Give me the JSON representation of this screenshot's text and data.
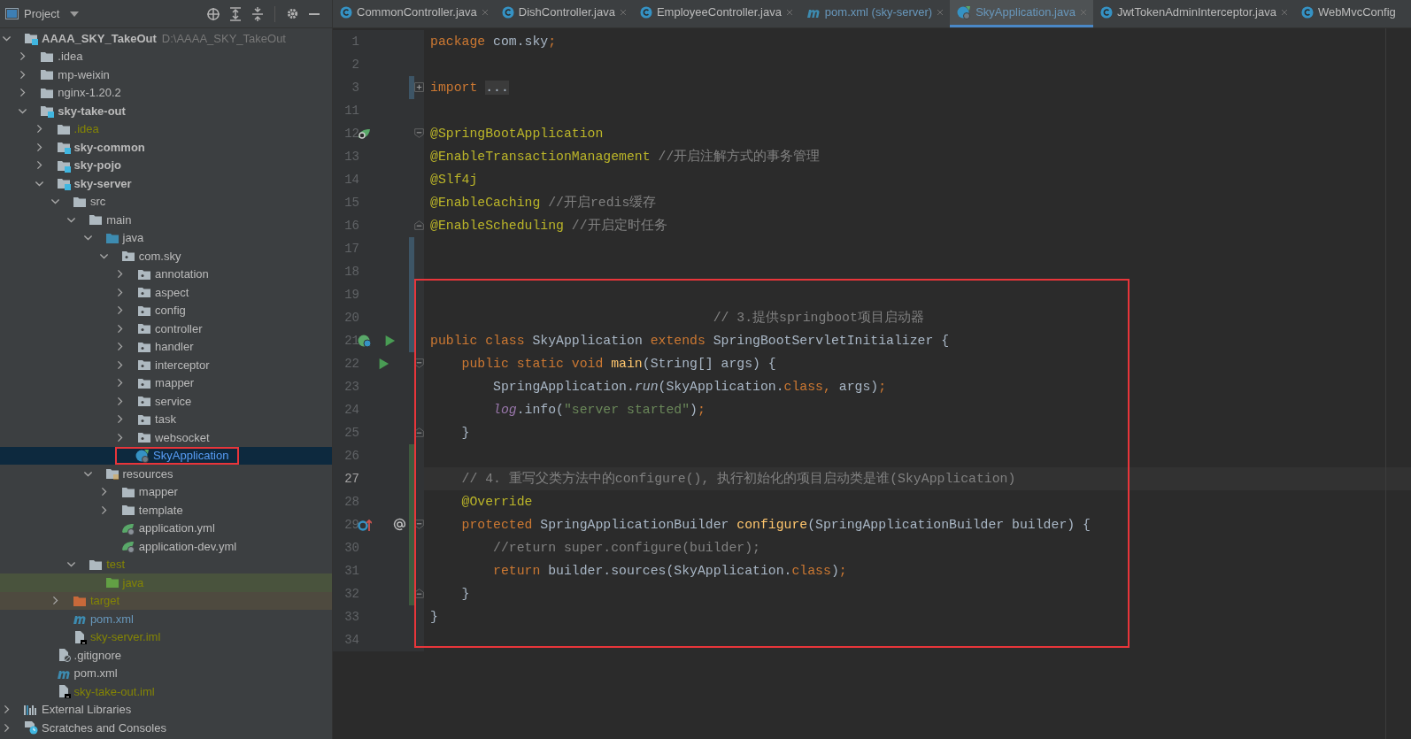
{
  "project_panel": {
    "title": "Project"
  },
  "tabs": [
    {
      "label": "CommonController.java",
      "kind": "class",
      "selected": false
    },
    {
      "label": "DishController.java",
      "kind": "class",
      "selected": false
    },
    {
      "label": "EmployeeController.java",
      "kind": "class",
      "selected": false
    },
    {
      "label": "pom.xml (sky-server)",
      "kind": "maven",
      "selected": false
    },
    {
      "label": "SkyApplication.java",
      "kind": "spring-class",
      "selected": true
    },
    {
      "label": "JwtTokenAdminInterceptor.java",
      "kind": "class",
      "selected": false
    },
    {
      "label": "WebMvcConfig",
      "kind": "class",
      "selected": false
    }
  ],
  "tree": [
    {
      "label": "AAAA_SKY_TakeOut",
      "path": "D:\\AAAA_SKY_TakeOut",
      "kind": "module",
      "color": "#bbbbbb",
      "expanded": true,
      "selected": false,
      "outlined": false,
      "children": [
        {
          "label": ".idea",
          "kind": "folder",
          "color": "#bbbbbb",
          "expanded": false,
          "selected": false,
          "outlined": false
        },
        {
          "label": "mp-weixin",
          "kind": "folder",
          "color": "#bbbbbb",
          "expanded": false,
          "selected": false,
          "outlined": false
        },
        {
          "label": "nginx-1.20.2",
          "kind": "folder",
          "color": "#bbbbbb",
          "expanded": false,
          "selected": false,
          "outlined": false
        },
        {
          "label": "sky-take-out",
          "kind": "module",
          "color": "#bbbbbb",
          "expanded": true,
          "selected": false,
          "outlined": false,
          "children": [
            {
              "label": ".idea",
              "kind": "folder",
              "color": "#848504",
              "expanded": false,
              "selected": false,
              "outlined": false
            },
            {
              "label": "sky-common",
              "kind": "module",
              "color": "#bbbbbb",
              "expanded": false,
              "selected": false,
              "outlined": false
            },
            {
              "label": "sky-pojo",
              "kind": "module",
              "color": "#bbbbbb",
              "expanded": false,
              "selected": false,
              "outlined": false
            },
            {
              "label": "sky-server",
              "kind": "module",
              "color": "#bbbbbb",
              "expanded": true,
              "selected": false,
              "outlined": false,
              "children": [
                {
                  "label": "src",
                  "kind": "folder",
                  "color": "#bbbbbb",
                  "expanded": true,
                  "selected": false,
                  "outlined": false,
                  "children": [
                    {
                      "label": "main",
                      "kind": "folder",
                      "color": "#bbbbbb",
                      "expanded": true,
                      "selected": false,
                      "outlined": false,
                      "children": [
                        {
                          "label": "java",
                          "kind": "source-root",
                          "color": "#bbbbbb",
                          "expanded": true,
                          "selected": false,
                          "outlined": false,
                          "children": [
                            {
                              "label": "com.sky",
                              "kind": "package",
                              "color": "#bbbbbb",
                              "expanded": true,
                              "selected": false,
                              "outlined": false,
                              "children": [
                                {
                                  "label": "annotation",
                                  "kind": "package",
                                  "color": "#bbbbbb",
                                  "expanded": false,
                                  "selected": false,
                                  "outlined": false
                                },
                                {
                                  "label": "aspect",
                                  "kind": "package",
                                  "color": "#bbbbbb",
                                  "expanded": false,
                                  "selected": false,
                                  "outlined": false
                                },
                                {
                                  "label": "config",
                                  "kind": "package",
                                  "color": "#bbbbbb",
                                  "expanded": false,
                                  "selected": false,
                                  "outlined": false
                                },
                                {
                                  "label": "controller",
                                  "kind": "package",
                                  "color": "#bbbbbb",
                                  "expanded": false,
                                  "selected": false,
                                  "outlined": false
                                },
                                {
                                  "label": "handler",
                                  "kind": "package",
                                  "color": "#bbbbbb",
                                  "expanded": false,
                                  "selected": false,
                                  "outlined": false
                                },
                                {
                                  "label": "interceptor",
                                  "kind": "package",
                                  "color": "#bbbbbb",
                                  "expanded": false,
                                  "selected": false,
                                  "outlined": false
                                },
                                {
                                  "label": "mapper",
                                  "kind": "package",
                                  "color": "#bbbbbb",
                                  "expanded": false,
                                  "selected": false,
                                  "outlined": false
                                },
                                {
                                  "label": "service",
                                  "kind": "package",
                                  "color": "#bbbbbb",
                                  "expanded": false,
                                  "selected": false,
                                  "outlined": false
                                },
                                {
                                  "label": "task",
                                  "kind": "package",
                                  "color": "#bbbbbb",
                                  "expanded": false,
                                  "selected": false,
                                  "outlined": false
                                },
                                {
                                  "label": "websocket",
                                  "kind": "package",
                                  "color": "#bbbbbb",
                                  "expanded": false,
                                  "selected": false,
                                  "outlined": false
                                },
                                {
                                  "label": "SkyApplication",
                                  "kind": "spring-class",
                                  "selected": true,
                                  "outlined": true
                                }
                              ]
                            }
                          ]
                        },
                        {
                          "label": "resources",
                          "kind": "resources-root",
                          "color": "#bbbbbb",
                          "expanded": true,
                          "selected": false,
                          "outlined": false,
                          "children": [
                            {
                              "label": "mapper",
                              "kind": "folder",
                              "color": "#bbbbbb",
                              "expanded": false,
                              "selected": false,
                              "outlined": false
                            },
                            {
                              "label": "template",
                              "kind": "folder",
                              "color": "#bbbbbb",
                              "expanded": false,
                              "selected": false,
                              "outlined": false
                            },
                            {
                              "label": "application.yml",
                              "kind": "spring-config",
                              "color": "#bbbbbb",
                              "selected": false,
                              "outlined": false
                            },
                            {
                              "label": "application-dev.yml",
                              "kind": "spring-config",
                              "color": "#bbbbbb",
                              "selected": false,
                              "outlined": false
                            }
                          ]
                        }
                      ]
                    },
                    {
                      "label": "test",
                      "kind": "folder",
                      "color": "#848504",
                      "expanded": true,
                      "selected": false,
                      "outlined": false,
                      "children": [
                        {
                          "label": "java",
                          "kind": "test-root",
                          "color": "#848504",
                          "selected": false,
                          "outlined": false
                        }
                      ]
                    }
                  ]
                },
                {
                  "label": "target",
                  "kind": "excluded",
                  "color": "#848504",
                  "expanded": false,
                  "selected": false,
                  "outlined": false
                },
                {
                  "label": "pom.xml",
                  "kind": "maven",
                  "color": "#6897bb",
                  "selected": false,
                  "outlined": false
                },
                {
                  "label": "sky-server.iml",
                  "kind": "iml",
                  "color": "#848504",
                  "selected": false,
                  "outlined": false
                }
              ]
            },
            {
              "label": ".gitignore",
              "kind": "gitignore",
              "color": "#bbbbbb",
              "selected": false,
              "outlined": false
            },
            {
              "label": "pom.xml",
              "kind": "maven",
              "color": "#bbbbbb",
              "selected": false,
              "outlined": false
            },
            {
              "label": "sky-take-out.iml",
              "kind": "iml",
              "color": "#848504",
              "selected": false,
              "outlined": false
            }
          ]
        }
      ]
    },
    {
      "label": "External Libraries",
      "kind": "libraries",
      "color": "#bbbbbb",
      "expanded": false,
      "selected": false,
      "outlined": false
    },
    {
      "label": "Scratches and Consoles",
      "kind": "scratches",
      "color": "#bbbbbb",
      "expanded": false,
      "selected": false,
      "outlined": false
    }
  ],
  "editor": {
    "blocks": [
      {
        "outlined": false,
        "lines": [
          {
            "number": "1",
            "current": false,
            "segments": [
              {
                "text": "package",
                "kind": "keyword"
              },
              {
                "text": " com.sky",
                "kind": "plain"
              },
              {
                "text": ";",
                "kind": "keyword"
              }
            ]
          },
          {
            "number": "2",
            "current": false
          },
          {
            "number": "3",
            "current": false,
            "gutter": [
              {
                "kind": "modified"
              },
              {
                "kind": "fold-collapsed"
              }
            ],
            "segments": [
              {
                "text": "import ",
                "kind": "keyword"
              },
              {
                "text": "...",
                "kind": "folded"
              }
            ]
          },
          {
            "number": "11",
            "current": false
          },
          {
            "number": "12",
            "current": false,
            "gutter": [
              {
                "kind": "bean"
              },
              {
                "kind": "fold-start"
              }
            ],
            "segments": [
              {
                "text": "@SpringBootApplication",
                "kind": "annotation"
              }
            ]
          },
          {
            "number": "13",
            "current": false,
            "segments": [
              {
                "text": "@EnableTransactionManagement",
                "kind": "annotation"
              },
              {
                "text": " //开启注解方式的事务管理",
                "kind": "comment"
              }
            ]
          },
          {
            "number": "14",
            "current": false,
            "segments": [
              {
                "text": "@Slf4j",
                "kind": "annotation"
              }
            ]
          },
          {
            "number": "15",
            "current": false,
            "segments": [
              {
                "text": "@EnableCaching",
                "kind": "annotation"
              },
              {
                "text": " //开启redis缓存",
                "kind": "comment"
              }
            ]
          },
          {
            "number": "16",
            "current": false,
            "gutter": [
              {
                "kind": "fold-end"
              }
            ],
            "segments": [
              {
                "text": "@EnableScheduling",
                "kind": "annotation"
              },
              {
                "text": " //开启定时任务",
                "kind": "comment"
              }
            ]
          },
          {
            "number": "17",
            "current": false,
            "gutter": [
              {
                "kind": "modified"
              }
            ]
          },
          {
            "number": "18",
            "current": false,
            "gutter": [
              {
                "kind": "modified"
              }
            ]
          }
        ]
      },
      {
        "outlined": true,
        "lines": [
          {
            "number": "19",
            "current": false,
            "gutter": [
              {
                "kind": "modified"
              }
            ]
          },
          {
            "number": "20",
            "current": false,
            "gutter": [
              {
                "kind": "modified"
              }
            ],
            "segments": [
              {
                "text": "                                    // 3.提供springboot项目启动器",
                "kind": "comment"
              }
            ]
          },
          {
            "number": "21",
            "current": false,
            "gutter": [
              {
                "kind": "modified"
              },
              {
                "kind": "spring"
              },
              {
                "kind": "run"
              }
            ],
            "segments": [
              {
                "text": "public class",
                "kind": "keyword"
              },
              {
                "text": " SkyApplication ",
                "kind": "plain"
              },
              {
                "text": "extends",
                "kind": "keyword"
              },
              {
                "text": " SpringBootServletInitializer {",
                "kind": "plain"
              }
            ]
          },
          {
            "number": "22",
            "current": false,
            "gutter": [
              {
                "kind": "run-small"
              },
              {
                "kind": "fold-start"
              }
            ],
            "segments": [
              {
                "text": "    public static void ",
                "kind": "keyword"
              },
              {
                "text": "main",
                "kind": "method"
              },
              {
                "text": "(String[] args) {",
                "kind": "plain"
              }
            ]
          },
          {
            "number": "23",
            "current": false,
            "segments": [
              {
                "text": "        SpringApplication.",
                "kind": "plain"
              },
              {
                "text": "run",
                "kind": "static-call"
              },
              {
                "text": "(SkyApplication.",
                "kind": "plain"
              },
              {
                "text": "class,",
                "kind": "keyword"
              },
              {
                "text": " args)",
                "kind": "plain"
              },
              {
                "text": ";",
                "kind": "keyword"
              }
            ]
          },
          {
            "number": "24",
            "current": false,
            "segments": [
              {
                "text": "        log",
                "kind": "field"
              },
              {
                "text": ".info(",
                "kind": "plain"
              },
              {
                "text": "\"server started\"",
                "kind": "string"
              },
              {
                "text": ")",
                "kind": "plain"
              },
              {
                "text": ";",
                "kind": "keyword"
              }
            ]
          },
          {
            "number": "25",
            "current": false,
            "gutter": [
              {
                "kind": "fold-end"
              }
            ],
            "segments": [
              {
                "text": "    }",
                "kind": "plain"
              }
            ]
          },
          {
            "number": "26",
            "current": false,
            "gutter": [
              {
                "kind": "added"
              }
            ]
          },
          {
            "number": "27",
            "current": true,
            "gutter": [
              {
                "kind": "added"
              }
            ],
            "segments": [
              {
                "text": "    // 4. 重写父类方法中的configure(), 执行初始化的项目启动类是谁(SkyApplication)",
                "kind": "comment"
              }
            ]
          },
          {
            "number": "28",
            "current": false,
            "gutter": [
              {
                "kind": "added"
              }
            ],
            "segments": [
              {
                "text": "    @Override",
                "kind": "annotation"
              }
            ]
          },
          {
            "number": "29",
            "current": false,
            "gutter": [
              {
                "kind": "added"
              },
              {
                "kind": "override"
              },
              {
                "kind": "at"
              },
              {
                "kind": "fold-start"
              }
            ],
            "segments": [
              {
                "text": "    protected",
                "kind": "keyword"
              },
              {
                "text": " SpringApplicationBuilder ",
                "kind": "plain"
              },
              {
                "text": "configure",
                "kind": "method"
              },
              {
                "text": "(SpringApplicationBuilder builder) {",
                "kind": "plain"
              }
            ]
          },
          {
            "number": "30",
            "current": false,
            "gutter": [
              {
                "kind": "added"
              }
            ],
            "segments": [
              {
                "text": "        //return super.configure(builder);",
                "kind": "comment"
              }
            ]
          },
          {
            "number": "31",
            "current": false,
            "gutter": [
              {
                "kind": "added"
              }
            ],
            "segments": [
              {
                "text": "        return",
                "kind": "keyword"
              },
              {
                "text": " builder.sources(SkyApplication.",
                "kind": "plain"
              },
              {
                "text": "class",
                "kind": "keyword"
              },
              {
                "text": ")",
                "kind": "plain"
              },
              {
                "text": ";",
                "kind": "keyword"
              }
            ]
          },
          {
            "number": "32",
            "current": false,
            "gutter": [
              {
                "kind": "added"
              },
              {
                "kind": "fold-end"
              }
            ],
            "segments": [
              {
                "text": "    }",
                "kind": "plain"
              }
            ]
          },
          {
            "number": "33",
            "current": false,
            "segments": [
              {
                "text": "}",
                "kind": "plain"
              }
            ]
          },
          {
            "number": "34",
            "current": false
          }
        ]
      }
    ]
  }
}
